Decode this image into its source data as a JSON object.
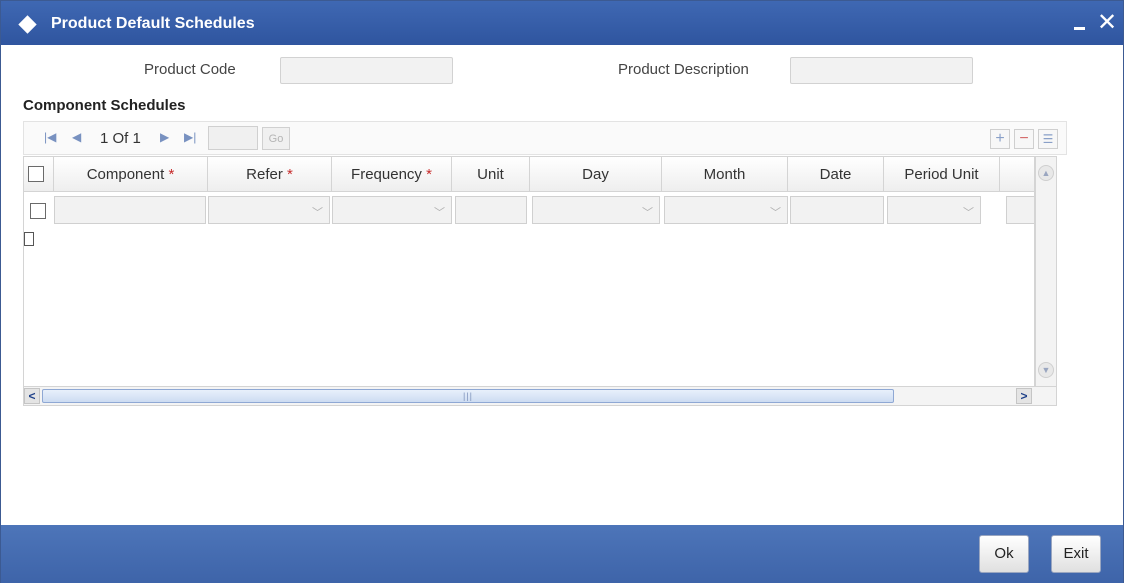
{
  "window": {
    "title": "Product Default Schedules",
    "minimize_glyph": "_",
    "close_glyph": "✕"
  },
  "form": {
    "product_code_label": "Product Code",
    "product_code_value": "",
    "product_description_label": "Product Description",
    "product_description_value": ""
  },
  "section": {
    "title": "Component Schedules"
  },
  "pager": {
    "page_text": "1 Of 1",
    "page_input_value": "",
    "go_label": "Go"
  },
  "grid": {
    "columns": [
      {
        "label": "Component",
        "required": true
      },
      {
        "label": "Refer",
        "required": true
      },
      {
        "label": "Frequency",
        "required": true
      },
      {
        "label": "Unit",
        "required": false
      },
      {
        "label": "Day",
        "required": false
      },
      {
        "label": "Month",
        "required": false
      },
      {
        "label": "Date",
        "required": false
      },
      {
        "label": "Period Unit",
        "required": false
      }
    ],
    "required_mark": "*",
    "rows": [
      {
        "component": "",
        "refer": "",
        "frequency": "",
        "unit": "",
        "day": "",
        "month": "",
        "date": "",
        "period_unit": ""
      }
    ]
  },
  "footer": {
    "ok_label": "Ok",
    "exit_label": "Exit"
  },
  "colors": {
    "titlebar": "#3f68b3",
    "footer": "#4d75b9",
    "required": "#c62a2a"
  }
}
